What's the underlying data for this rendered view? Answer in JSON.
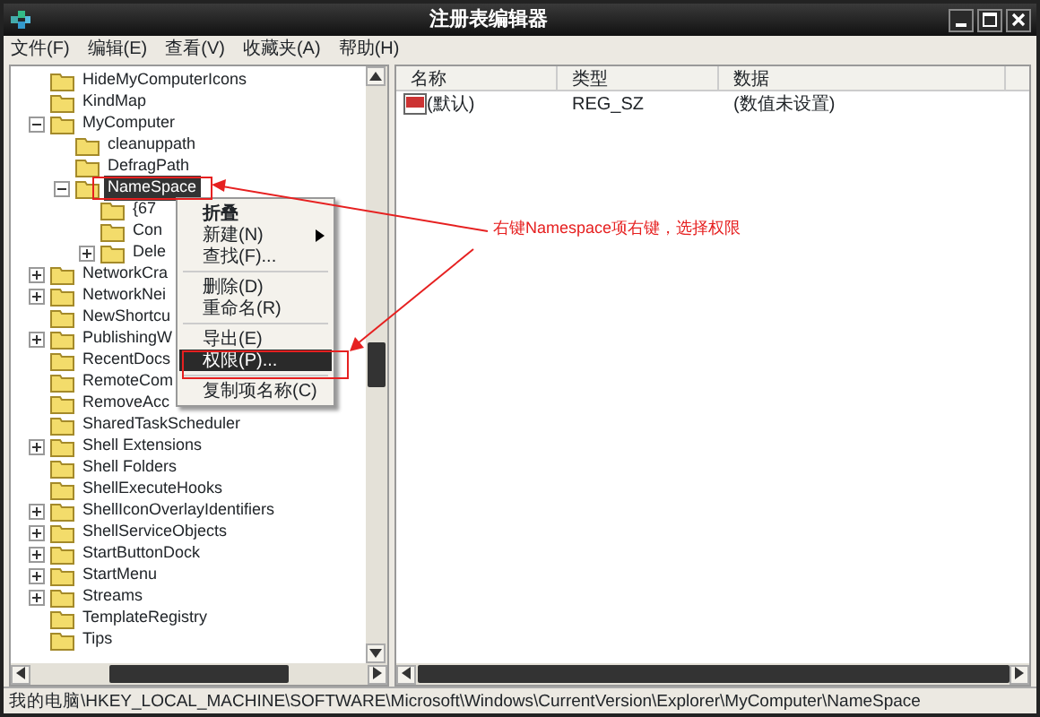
{
  "window": {
    "title": "注册表编辑器"
  },
  "menu": [
    "文件(F)",
    "编辑(E)",
    "查看(V)",
    "收藏夹(A)",
    "帮助(H)"
  ],
  "tree": [
    {
      "label": "HideMyComputerIcons",
      "selected": false
    },
    {
      "label": "KindMap",
      "selected": false
    },
    {
      "label": "MyComputer",
      "expanded": true,
      "selected": false,
      "children": [
        {
          "label": "cleanuppath",
          "selected": false
        },
        {
          "label": "DefragPath",
          "selected": false
        },
        {
          "label": "NameSpace",
          "expanded": true,
          "selected": true,
          "children": [
            {
              "label": "{67",
              "selected": false
            },
            {
              "label": "Con",
              "selected": false
            },
            {
              "label": "Dele",
              "expanded": false,
              "selected": false
            }
          ]
        }
      ]
    },
    {
      "label": "NetworkCra",
      "expanded": false,
      "selected": false
    },
    {
      "label": "NetworkNei",
      "expanded": false,
      "selected": false
    },
    {
      "label": "NewShortcu",
      "selected": false
    },
    {
      "label": "PublishingW",
      "expanded": false,
      "selected": false
    },
    {
      "label": "RecentDocs",
      "selected": false
    },
    {
      "label": "RemoteCom",
      "selected": false
    },
    {
      "label": "RemoveAcc",
      "selected": false
    },
    {
      "label": "SharedTaskScheduler",
      "selected": false
    },
    {
      "label": "Shell Extensions",
      "expanded": false,
      "selected": false
    },
    {
      "label": "Shell Folders",
      "selected": false
    },
    {
      "label": "ShellExecuteHooks",
      "selected": false
    },
    {
      "label": "ShellIconOverlayIdentifiers",
      "expanded": false,
      "selected": false
    },
    {
      "label": "ShellServiceObjects",
      "expanded": false,
      "selected": false
    },
    {
      "label": "StartButtonDock",
      "expanded": false,
      "selected": false
    },
    {
      "label": "StartMenu",
      "expanded": false,
      "selected": false
    },
    {
      "label": "Streams",
      "expanded": false,
      "selected": false
    },
    {
      "label": "TemplateRegistry",
      "selected": false
    },
    {
      "label": "Tips",
      "selected": false
    }
  ],
  "list": {
    "columns": [
      "名称",
      "类型",
      "数据"
    ],
    "rows": [
      {
        "name": "(默认)",
        "type": "REG_SZ",
        "data": "(数值未设置)"
      }
    ]
  },
  "context_menu": [
    {
      "kind": "default",
      "label": "折叠",
      "selected": false
    },
    {
      "kind": "submenu",
      "label": "新建(N)",
      "selected": false
    },
    {
      "kind": "item",
      "label": "查找(F)...",
      "selected": false
    },
    {
      "kind": "separator"
    },
    {
      "kind": "item",
      "label": "删除(D)",
      "selected": false
    },
    {
      "kind": "item",
      "label": "重命名(R)",
      "selected": false
    },
    {
      "kind": "separator"
    },
    {
      "kind": "item",
      "label": "导出(E)",
      "selected": false
    },
    {
      "kind": "item",
      "label": "权限(P)...",
      "selected": true
    },
    {
      "kind": "separator"
    },
    {
      "kind": "item",
      "label": "复制项名称(C)",
      "selected": false
    }
  ],
  "annotation": {
    "text": "右键Namespace项右键，选择权限"
  },
  "status_bar": "我的电脑\\HKEY_LOCAL_MACHINE\\SOFTWARE\\Microsoft\\Windows\\CurrentVersion\\Explorer\\MyComputer\\NameSpace"
}
